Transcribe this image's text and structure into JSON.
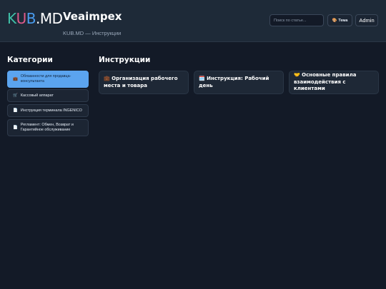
{
  "header": {
    "logo": {
      "k": "K",
      "u": "U",
      "b": "B",
      "dot": ".",
      "md": "MD"
    },
    "site_name": "Veaimpex",
    "breadcrumb": "KUB.MD — Инструкции",
    "search_placeholder": "Поиск по статье...",
    "theme_icon": "🎨",
    "theme_label": "Тема",
    "admin_label": "Admin"
  },
  "sidebar": {
    "title": "Категории",
    "items": [
      {
        "icon": "💼",
        "label": "Обязанности для продавца-консультанта",
        "active": true
      },
      {
        "icon": "🛒",
        "label": "Кассовый аппарат",
        "active": false
      },
      {
        "icon": "📄",
        "label": "Инструкция терминала INGENICO",
        "active": false
      },
      {
        "icon": "📄",
        "label": "Регламент: Обмен, Возврат и Гарантийное обслуживание",
        "active": false
      }
    ]
  },
  "main": {
    "title": "Инструкции",
    "cards": [
      {
        "icon": "💼",
        "label": "Организация рабочего места и товара"
      },
      {
        "icon": "🗓️",
        "label": "Инструкция: Рабочий день"
      },
      {
        "icon": "🤝",
        "label": "Основные правила взаимодействия с клиентами"
      }
    ]
  },
  "colors": {
    "logo_k": "#3fc0a8",
    "logo_u": "#e05a8c",
    "logo_b": "#4a9df0",
    "accent": "#5ba4ef",
    "background": "#131a27"
  }
}
